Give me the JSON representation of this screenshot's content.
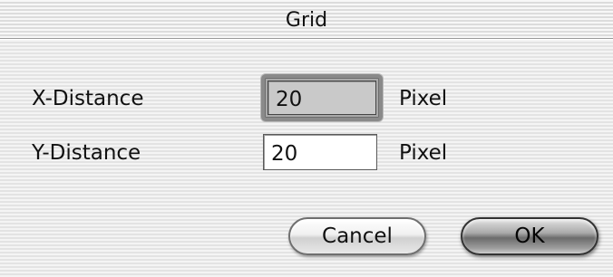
{
  "window": {
    "title": "Grid"
  },
  "fields": {
    "x": {
      "label": "X-Distance",
      "value": "20",
      "unit": "Pixel"
    },
    "y": {
      "label": "Y-Distance",
      "value": "20",
      "unit": "Pixel"
    }
  },
  "buttons": {
    "cancel_label": "Cancel",
    "ok_label": "OK"
  }
}
